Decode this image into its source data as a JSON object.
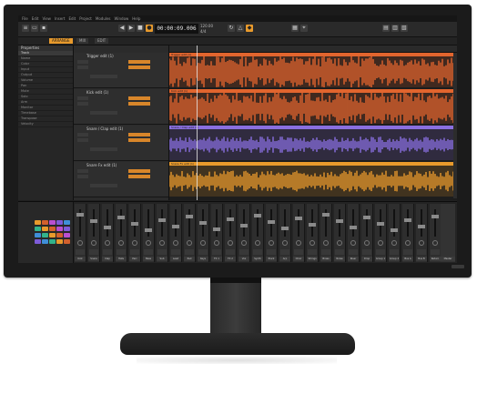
{
  "menu": [
    "File",
    "Edit",
    "View",
    "Insert",
    "Edit",
    "Project",
    "Modules",
    "Window",
    "Help"
  ],
  "transport": {
    "timecode": "00:00:09.006",
    "tempo": "120.00",
    "time_signature": "4/4"
  },
  "tabs": [
    "ARRANGE",
    "MIX",
    "EDIT"
  ],
  "inspector": {
    "title": "Properties",
    "rows": [
      "Track",
      "Name",
      "Color",
      "Input",
      "Output",
      "Volume",
      "Pan",
      "Mute",
      "Solo",
      "Arm",
      "Monitor",
      "Timebase",
      "Transpose",
      "Velocity"
    ]
  },
  "tracks": [
    {
      "name": "Trigger edit (1)",
      "color": "#e2652e"
    },
    {
      "name": "Kick edit (1)",
      "color": "#e2652e"
    },
    {
      "name": "Snare / Clap edit (1)",
      "color": "#8a6fe0"
    },
    {
      "name": "Snare Fx edit (1)",
      "color": "#e89a2c"
    }
  ],
  "mixer": {
    "channels": [
      "Kick",
      "Snare",
      "Clap",
      "Hats",
      "Perc",
      "Bass",
      "Sub",
      "Lead",
      "Pad",
      "Keys",
      "FX 1",
      "FX 2",
      "Vox",
      "Synth",
      "Pluck",
      "Arp",
      "Choir",
      "Strings",
      "Brass",
      "Noise",
      "Riser",
      "Drop",
      "Group 1",
      "Group 2",
      "Bus A",
      "Bus B",
      "Return",
      "Master"
    ],
    "master_label": "Master"
  },
  "colors": {
    "accent": "#e89a2c",
    "orange_wave": "#e2652e",
    "purple_wave": "#8a6fe0",
    "gold_wave": "#e89a2c"
  }
}
